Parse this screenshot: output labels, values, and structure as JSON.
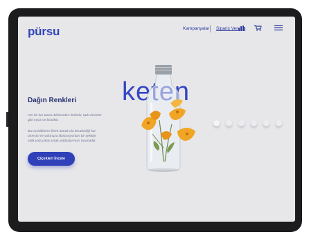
{
  "header": {
    "logo": "pürsu",
    "nav_campaigns": "Kampanyalar",
    "nav_order": "Sipariş Ver"
  },
  "hero": {
    "headline": "Dağın Renkleri",
    "paragraph_1": "Her bir kar tanesi birbirinden farklıdır, tıpkı kesinler gibi eşsiz ve biriciktir.",
    "paragraph_2": "Bu eşsizliklerin fikrini alarak ola beraberliği kar tanesini ve yolunuza illustrasyonları bir şekilde eşlik yola çıkan ortak yoldaşlarımızı tasarladık.",
    "cta_label": "Çiçekleri İncele",
    "brand_word": "keten"
  },
  "colors": {
    "accent": "#3040b8",
    "background": "#e7e7ea",
    "flower": "#f0a524"
  },
  "carousel": {
    "count": 6,
    "active_index": 0
  }
}
